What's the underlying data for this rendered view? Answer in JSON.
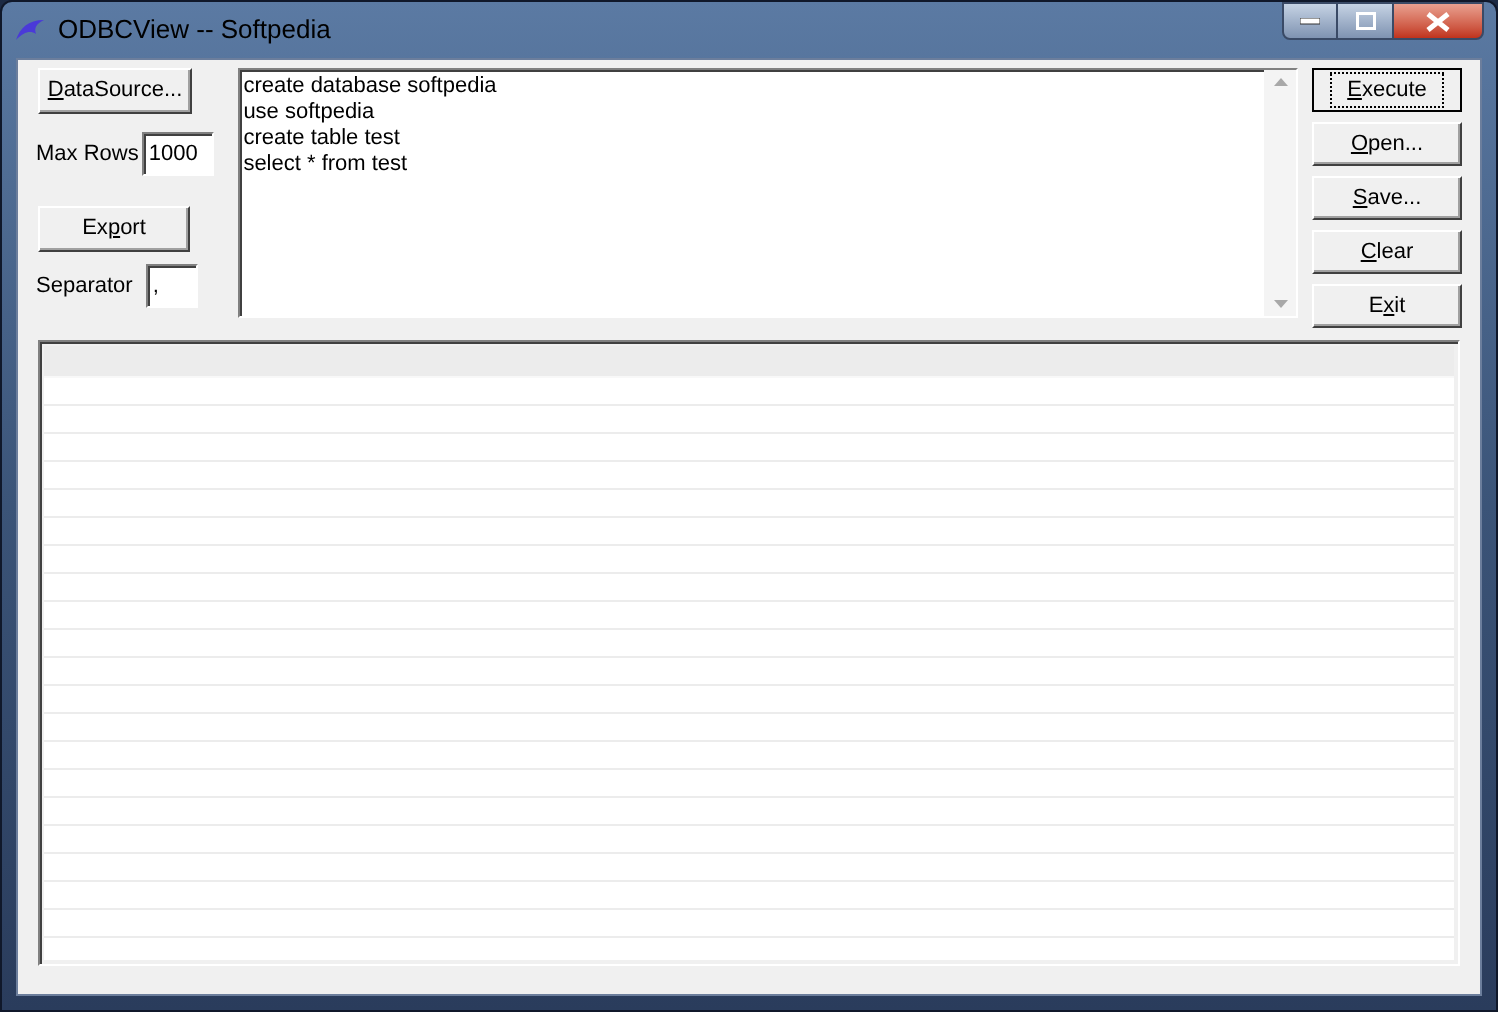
{
  "window": {
    "title": "ODBCView -- Softpedia"
  },
  "left_panel": {
    "datasource_button": {
      "label": {
        "mnemonic": "D",
        "after": "ataSource..."
      }
    },
    "max_rows": {
      "label": "Max Rows",
      "value": "1000"
    },
    "export_button": {
      "label": {
        "before": "Ex",
        "mnemonic": "p",
        "after": "ort"
      }
    },
    "separator": {
      "label": "Separator",
      "value": ","
    }
  },
  "query_editor": {
    "lines": [
      "create database softpedia",
      "use softpedia",
      "create table test",
      "select * from test"
    ]
  },
  "buttons": [
    {
      "label": {
        "mnemonic": "E",
        "after": "xecute"
      },
      "focused": true
    },
    {
      "label": {
        "mnemonic": "O",
        "after": "pen..."
      },
      "focused": false
    },
    {
      "label": {
        "mnemonic": "S",
        "after": "ave..."
      },
      "focused": false
    },
    {
      "label": {
        "mnemonic": "C",
        "after": "lear"
      },
      "focused": false
    },
    {
      "label": {
        "before": "E",
        "mnemonic": "x",
        "after": "it"
      },
      "focused": false
    }
  ]
}
